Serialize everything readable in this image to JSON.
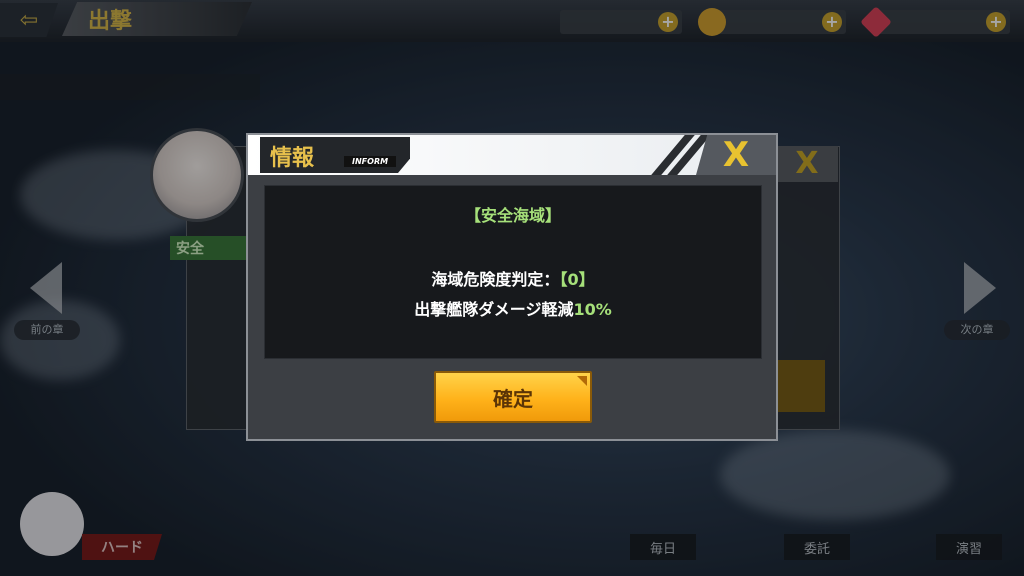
{
  "topbar": {
    "title": "出撃",
    "resources": [
      {
        "name": "oil",
        "value": "",
        "color": "#c9a530"
      },
      {
        "name": "coin",
        "value": "",
        "color": "#d3a232"
      },
      {
        "name": "gem",
        "value": "",
        "color": "#d9435a"
      }
    ]
  },
  "background": {
    "safe_label": "安全",
    "hard_label": "ハード",
    "nav_prev": "前の章",
    "nav_next": "次の章",
    "bottom_tabs": [
      "毎日",
      "委託",
      "演習"
    ],
    "sortie_label": "出撃"
  },
  "modal": {
    "title": "情報",
    "subtitle": "INFORM",
    "close_icon": "X",
    "area_title": "【安全海域】",
    "danger_prefix": "海域危険度判定：",
    "danger_value": "【0】",
    "damage_prefix": "出撃艦隊ダメージ軽減",
    "damage_value": "10%",
    "confirm_label": "確定"
  }
}
